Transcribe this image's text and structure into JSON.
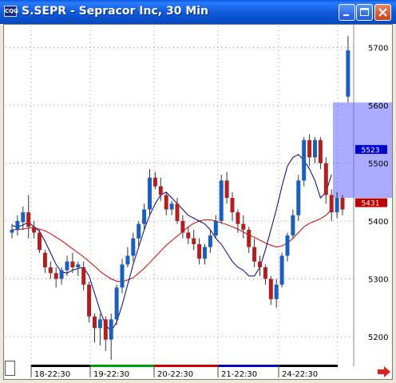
{
  "window": {
    "title": "S.SEPR - Sepracor Inc, 30 Min",
    "icon": "app-icon"
  },
  "titlebar_buttons": [
    "minimize-icon",
    "maximize-icon",
    "close-icon"
  ],
  "colors": {
    "up": "#1a5fc0",
    "down": "#b02020",
    "ma_fast": "#00008b",
    "ma_slow": "#d00000",
    "highlight": "#6666ff",
    "price_tag": "#0000d0",
    "red_tag": "#c00000"
  },
  "chart_data": {
    "type": "candlestick",
    "ylim": [
      5170,
      5750
    ],
    "y_ticks": [
      "5700",
      "5600",
      "5500",
      "5400",
      "5300",
      "5200"
    ],
    "x_labels": [
      "18-22:30",
      "19-22:30",
      "20-22:30",
      "21-22:30",
      "24-22:30"
    ],
    "day_bar_colors": [
      "#000000",
      "#00a000",
      "#d00000",
      "#0000c0",
      "#000000"
    ],
    "price_tags": {
      "current": "5523",
      "red": "5431"
    },
    "highlight_range": [
      5440,
      5605
    ],
    "candles": [
      {
        "o": 5380,
        "h": 5395,
        "l": 5370,
        "c": 5385
      },
      {
        "o": 5385,
        "h": 5410,
        "l": 5375,
        "c": 5400
      },
      {
        "o": 5398,
        "h": 5425,
        "l": 5385,
        "c": 5415
      },
      {
        "o": 5415,
        "h": 5445,
        "l": 5370,
        "c": 5390
      },
      {
        "o": 5390,
        "h": 5400,
        "l": 5370,
        "c": 5380
      },
      {
        "o": 5380,
        "h": 5385,
        "l": 5345,
        "c": 5350
      },
      {
        "o": 5345,
        "h": 5350,
        "l": 5310,
        "c": 5320
      },
      {
        "o": 5320,
        "h": 5330,
        "l": 5300,
        "c": 5310
      },
      {
        "o": 5310,
        "h": 5320,
        "l": 5285,
        "c": 5300
      },
      {
        "o": 5300,
        "h": 5320,
        "l": 5290,
        "c": 5315
      },
      {
        "o": 5315,
        "h": 5340,
        "l": 5305,
        "c": 5330
      },
      {
        "o": 5330,
        "h": 5345,
        "l": 5310,
        "c": 5320
      },
      {
        "o": 5320,
        "h": 5330,
        "l": 5305,
        "c": 5325
      },
      {
        "o": 5320,
        "h": 5330,
        "l": 5280,
        "c": 5290
      },
      {
        "o": 5290,
        "h": 5295,
        "l": 5225,
        "c": 5235
      },
      {
        "o": 5235,
        "h": 5240,
        "l": 5190,
        "c": 5215
      },
      {
        "o": 5215,
        "h": 5240,
        "l": 5185,
        "c": 5230
      },
      {
        "o": 5230,
        "h": 5235,
        "l": 5175,
        "c": 5195
      },
      {
        "o": 5195,
        "h": 5240,
        "l": 5160,
        "c": 5230
      },
      {
        "o": 5230,
        "h": 5290,
        "l": 5220,
        "c": 5285
      },
      {
        "o": 5285,
        "h": 5335,
        "l": 5275,
        "c": 5325
      },
      {
        "o": 5325,
        "h": 5355,
        "l": 5320,
        "c": 5340
      },
      {
        "o": 5340,
        "h": 5380,
        "l": 5330,
        "c": 5370
      },
      {
        "o": 5370,
        "h": 5400,
        "l": 5355,
        "c": 5395
      },
      {
        "o": 5395,
        "h": 5430,
        "l": 5385,
        "c": 5420
      },
      {
        "o": 5420,
        "h": 5490,
        "l": 5410,
        "c": 5475
      },
      {
        "o": 5475,
        "h": 5485,
        "l": 5455,
        "c": 5460
      },
      {
        "o": 5460,
        "h": 5475,
        "l": 5435,
        "c": 5445
      },
      {
        "o": 5445,
        "h": 5450,
        "l": 5410,
        "c": 5420
      },
      {
        "o": 5420,
        "h": 5435,
        "l": 5410,
        "c": 5430
      },
      {
        "o": 5430,
        "h": 5440,
        "l": 5395,
        "c": 5400
      },
      {
        "o": 5400,
        "h": 5410,
        "l": 5370,
        "c": 5380
      },
      {
        "o": 5380,
        "h": 5390,
        "l": 5360,
        "c": 5370
      },
      {
        "o": 5370,
        "h": 5385,
        "l": 5350,
        "c": 5360
      },
      {
        "o": 5360,
        "h": 5370,
        "l": 5325,
        "c": 5335
      },
      {
        "o": 5335,
        "h": 5360,
        "l": 5325,
        "c": 5355
      },
      {
        "o": 5355,
        "h": 5385,
        "l": 5345,
        "c": 5375
      },
      {
        "o": 5375,
        "h": 5410,
        "l": 5370,
        "c": 5400
      },
      {
        "o": 5400,
        "h": 5480,
        "l": 5395,
        "c": 5470
      },
      {
        "o": 5470,
        "h": 5485,
        "l": 5430,
        "c": 5440
      },
      {
        "o": 5440,
        "h": 5450,
        "l": 5400,
        "c": 5415
      },
      {
        "o": 5415,
        "h": 5420,
        "l": 5380,
        "c": 5395
      },
      {
        "o": 5395,
        "h": 5410,
        "l": 5370,
        "c": 5385
      },
      {
        "o": 5385,
        "h": 5390,
        "l": 5345,
        "c": 5355
      },
      {
        "o": 5355,
        "h": 5370,
        "l": 5320,
        "c": 5330
      },
      {
        "o": 5330,
        "h": 5340,
        "l": 5305,
        "c": 5320
      },
      {
        "o": 5320,
        "h": 5325,
        "l": 5290,
        "c": 5300
      },
      {
        "o": 5300,
        "h": 5305,
        "l": 5255,
        "c": 5265
      },
      {
        "o": 5265,
        "h": 5300,
        "l": 5250,
        "c": 5290
      },
      {
        "o": 5290,
        "h": 5345,
        "l": 5285,
        "c": 5340
      },
      {
        "o": 5340,
        "h": 5380,
        "l": 5330,
        "c": 5375
      },
      {
        "o": 5375,
        "h": 5420,
        "l": 5370,
        "c": 5410
      },
      {
        "o": 5410,
        "h": 5480,
        "l": 5400,
        "c": 5470
      },
      {
        "o": 5470,
        "h": 5545,
        "l": 5460,
        "c": 5540
      },
      {
        "o": 5540,
        "h": 5550,
        "l": 5495,
        "c": 5510
      },
      {
        "o": 5510,
        "h": 5545,
        "l": 5500,
        "c": 5540
      },
      {
        "o": 5540,
        "h": 5545,
        "l": 5490,
        "c": 5500
      },
      {
        "o": 5500,
        "h": 5510,
        "l": 5430,
        "c": 5445
      },
      {
        "o": 5445,
        "h": 5455,
        "l": 5400,
        "c": 5415
      },
      {
        "o": 5415,
        "h": 5450,
        "l": 5405,
        "c": 5440
      },
      {
        "o": 5440,
        "h": 5445,
        "l": 5410,
        "c": 5420
      },
      {
        "o": 5615,
        "h": 5720,
        "l": 5605,
        "c": 5695
      }
    ],
    "ma_fast": [
      5392,
      5390,
      5393,
      5398,
      5390,
      5382,
      5365,
      5345,
      5325,
      5312,
      5310,
      5315,
      5318,
      5320,
      5305,
      5275,
      5245,
      5220,
      5210,
      5225,
      5255,
      5290,
      5325,
      5355,
      5385,
      5410,
      5430,
      5445,
      5450,
      5440,
      5430,
      5420,
      5410,
      5405,
      5400,
      5395,
      5385,
      5370,
      5360,
      5345,
      5330,
      5320,
      5315,
      5305,
      5305,
      5320,
      5350,
      5385,
      5420,
      5460,
      5495,
      5510,
      5515,
      5505,
      5490,
      5470,
      5440,
      5450,
      5480
    ],
    "ma_slow": [
      5385,
      5385,
      5386,
      5388,
      5388,
      5386,
      5383,
      5378,
      5372,
      5366,
      5359,
      5352,
      5345,
      5338,
      5330,
      5322,
      5313,
      5306,
      5300,
      5296,
      5295,
      5298,
      5302,
      5310,
      5318,
      5328,
      5338,
      5348,
      5358,
      5366,
      5374,
      5382,
      5390,
      5396,
      5400,
      5402,
      5402,
      5400,
      5397,
      5394,
      5390,
      5386,
      5381,
      5376,
      5372,
      5367,
      5362,
      5358,
      5355,
      5357,
      5362,
      5370,
      5380,
      5390,
      5396,
      5400,
      5404,
      5410,
      5420
    ]
  }
}
